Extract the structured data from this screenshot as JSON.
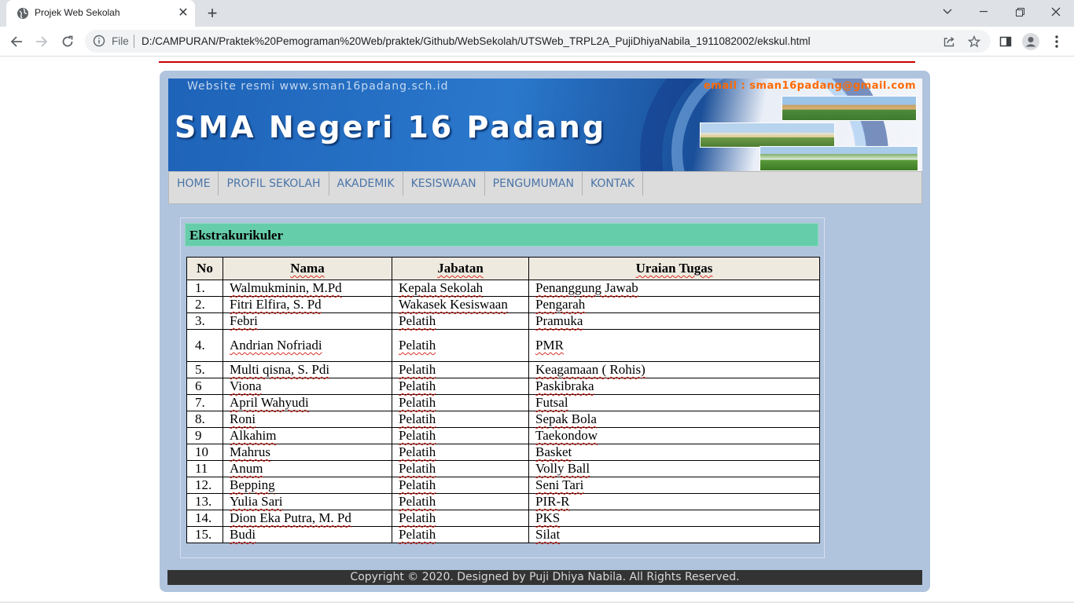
{
  "browser": {
    "tab_title": "Projek Web Sekolah",
    "protocol_label": "File",
    "url": "D:/CAMPURAN/Praktek%20Pemograman%20Web/praktek/Github/WebSekolah/UTSWeb_TRPL2A_PujiDhiyaNabila_1911082002/ekskul.html"
  },
  "banner": {
    "site_text": "Website resmi www.sman16padang.sch.id",
    "email_text": "email : sman16padang@gmail.com",
    "school_name": "SMA Negeri 16 Padang"
  },
  "menu": {
    "items": [
      {
        "label": "HOME"
      },
      {
        "label": "PROFIL SEKOLAH"
      },
      {
        "label": "AKADEMIK"
      },
      {
        "label": "KESISWAAN"
      },
      {
        "label": "PENGUMUMAN"
      },
      {
        "label": "KONTAK"
      }
    ]
  },
  "section": {
    "heading": "Ekstrakurikuler"
  },
  "table": {
    "headers": {
      "no": "No",
      "nama": "Nama",
      "jabatan": "Jabatan",
      "uraian": "Uraian Tugas"
    },
    "rows": [
      {
        "no": "1.",
        "nama": "Walmukminin, M.Pd",
        "jabatan": "Kepala Sekolah",
        "uraian": "Penanggung Jawab"
      },
      {
        "no": "2.",
        "nama": "Fitri Elfira, S. Pd",
        "jabatan": "Wakasek Kesiswaan",
        "uraian": "Pengarah"
      },
      {
        "no": "3.",
        "nama": "Febri",
        "jabatan": "Pelatih",
        "uraian": "Pramuka"
      },
      {
        "no": "4.",
        "nama": "Andrian Nofriadi",
        "jabatan": "Pelatih",
        "uraian": "PMR"
      },
      {
        "no": "5.",
        "nama": "Multi qisna, S. Pdi",
        "jabatan": "Pelatih",
        "uraian": "Keagamaan ( Rohis)"
      },
      {
        "no": "6",
        "nama": "Viona",
        "jabatan": "Pelatih",
        "uraian": "Paskibraka"
      },
      {
        "no": "7.",
        "nama": "April Wahyudi",
        "jabatan": "Pelatih",
        "uraian": "Futsal"
      },
      {
        "no": "8.",
        "nama": "Roni",
        "jabatan": "Pelatih",
        "uraian": "Sepak Bola"
      },
      {
        "no": "9",
        "nama": "Alkahim",
        "jabatan": "Pelatih",
        "uraian": "Taekondow"
      },
      {
        "no": "10",
        "nama": "Mahrus",
        "jabatan": "Pelatih",
        "uraian": "Basket"
      },
      {
        "no": "11",
        "nama": "Anum",
        "jabatan": "Pelatih",
        "uraian": "Volly Ball"
      },
      {
        "no": "12.",
        "nama": "Bepping",
        "jabatan": "Pelatih",
        "uraian": "Seni Tari"
      },
      {
        "no": "13.",
        "nama": "Yulia Sari",
        "jabatan": "Pelatih",
        "uraian": "PIR-R"
      },
      {
        "no": "14.",
        "nama": "Dion Eka Putra, M. Pd",
        "jabatan": "Pelatih",
        "uraian": "PKS"
      },
      {
        "no": "15.",
        "nama": "Budi",
        "jabatan": "Pelatih",
        "uraian": "Silat"
      }
    ]
  },
  "footer": {
    "text": "Copyright © 2020. Designed by Puji Dhiya Nabila. All Rights Reserved."
  },
  "colors": {
    "wrapper_bg": "#b0c4de",
    "heading_bg": "#66cdaa",
    "menu_link": "#4a74a8",
    "footer_bg": "#333333",
    "accent_line": "#cc0000"
  },
  "icons": {
    "tab_favicon": "globe-icon",
    "address_info": "info-icon",
    "share": "share-icon",
    "bookmark": "star-icon",
    "side_panel": "side-panel-icon",
    "profile": "profile-icon",
    "menu": "kebab-menu-icon"
  }
}
